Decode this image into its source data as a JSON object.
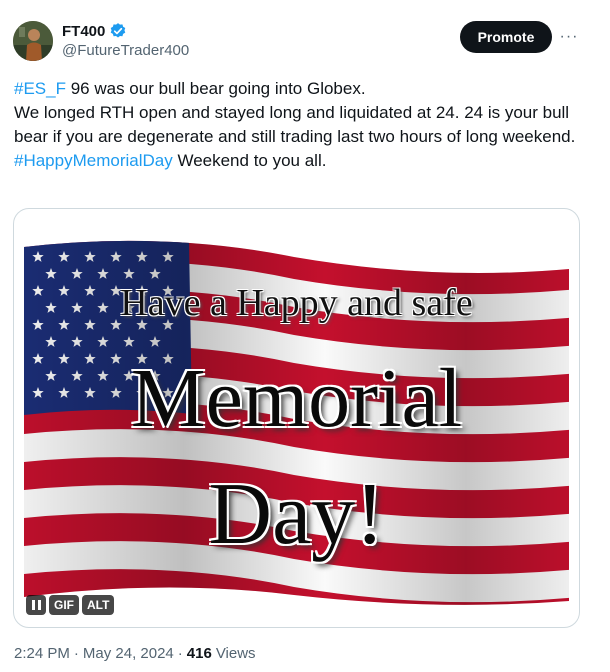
{
  "author": {
    "display_name": "FT400",
    "handle": "@FutureTrader400",
    "verified_icon": "verified-badge-icon",
    "verified_color": "#1d9bf0"
  },
  "header": {
    "promote_label": "Promote",
    "more_label": "···"
  },
  "tweet": {
    "line1_hashtag": "#ES_F",
    "line1_text": " 96 was our bull bear going into Globex.",
    "line2_text": "We longed RTH open and stayed long and liquidated at 24.  24 is your bull bear if you are degenerate and still trading last two hours of long weekend.",
    "line3_hashtag": "#HappyMemorialDay",
    "line3_text": " Weekend to you all."
  },
  "media": {
    "title_line": "Have a Happy and safe",
    "word1": "Memorial",
    "word2": "Day!",
    "controls": {
      "pause_icon": "pause-icon",
      "gif_label": "GIF",
      "alt_label": "ALT"
    },
    "colors": {
      "red": "#c8102e",
      "blue": "#1c2f7a",
      "white": "#ffffff"
    }
  },
  "footer": {
    "time": "2:24 PM",
    "separator": "·",
    "date": "May 24, 2024",
    "views_count": "416",
    "views_label": "Views"
  },
  "colors": {
    "accent": "#1d9bf0",
    "text": "#0f1419",
    "secondary": "#536471"
  }
}
